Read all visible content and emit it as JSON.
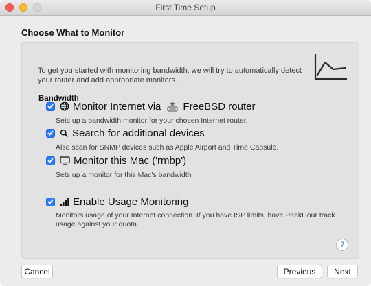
{
  "window": {
    "title": "First Time Setup"
  },
  "heading": "Choose What to Monitor",
  "section": {
    "title": "Bandwidth",
    "description": "To get you started with monitoring bandwidth, we will try to automatically detect your router and add appropriate monitors."
  },
  "options": [
    {
      "label_prefix": "Monitor Internet via",
      "router_name": "FreeBSD router",
      "checked": true,
      "icon": "globe-icon",
      "description": "Sets up a bandwidth monitor for your chosen Internet router."
    },
    {
      "label": "Search for additional devices",
      "checked": true,
      "icon": "magnifier-icon",
      "description": "Also scan for SNMP devices such as Apple Airport and Time Capsule."
    },
    {
      "label": "Monitor this Mac ('rmbp')",
      "checked": true,
      "icon": "display-icon",
      "description": "Sets up a monitor for this Mac's bandwidth"
    },
    {
      "label": "Enable Usage Monitoring",
      "checked": true,
      "icon": "bar-chart-icon",
      "description": "Monitors usage of your Internet connection. If you have ISP limits, have PeakHour track usage against your quota."
    }
  ],
  "help": {
    "label": "?"
  },
  "buttons": {
    "cancel": "Cancel",
    "previous": "Previous",
    "next": "Next"
  },
  "colors": {
    "checkbox": "#2f7df6",
    "close": "#fc5f57",
    "minimize": "#fdbc2e",
    "zoom": "#d6d6d6"
  }
}
